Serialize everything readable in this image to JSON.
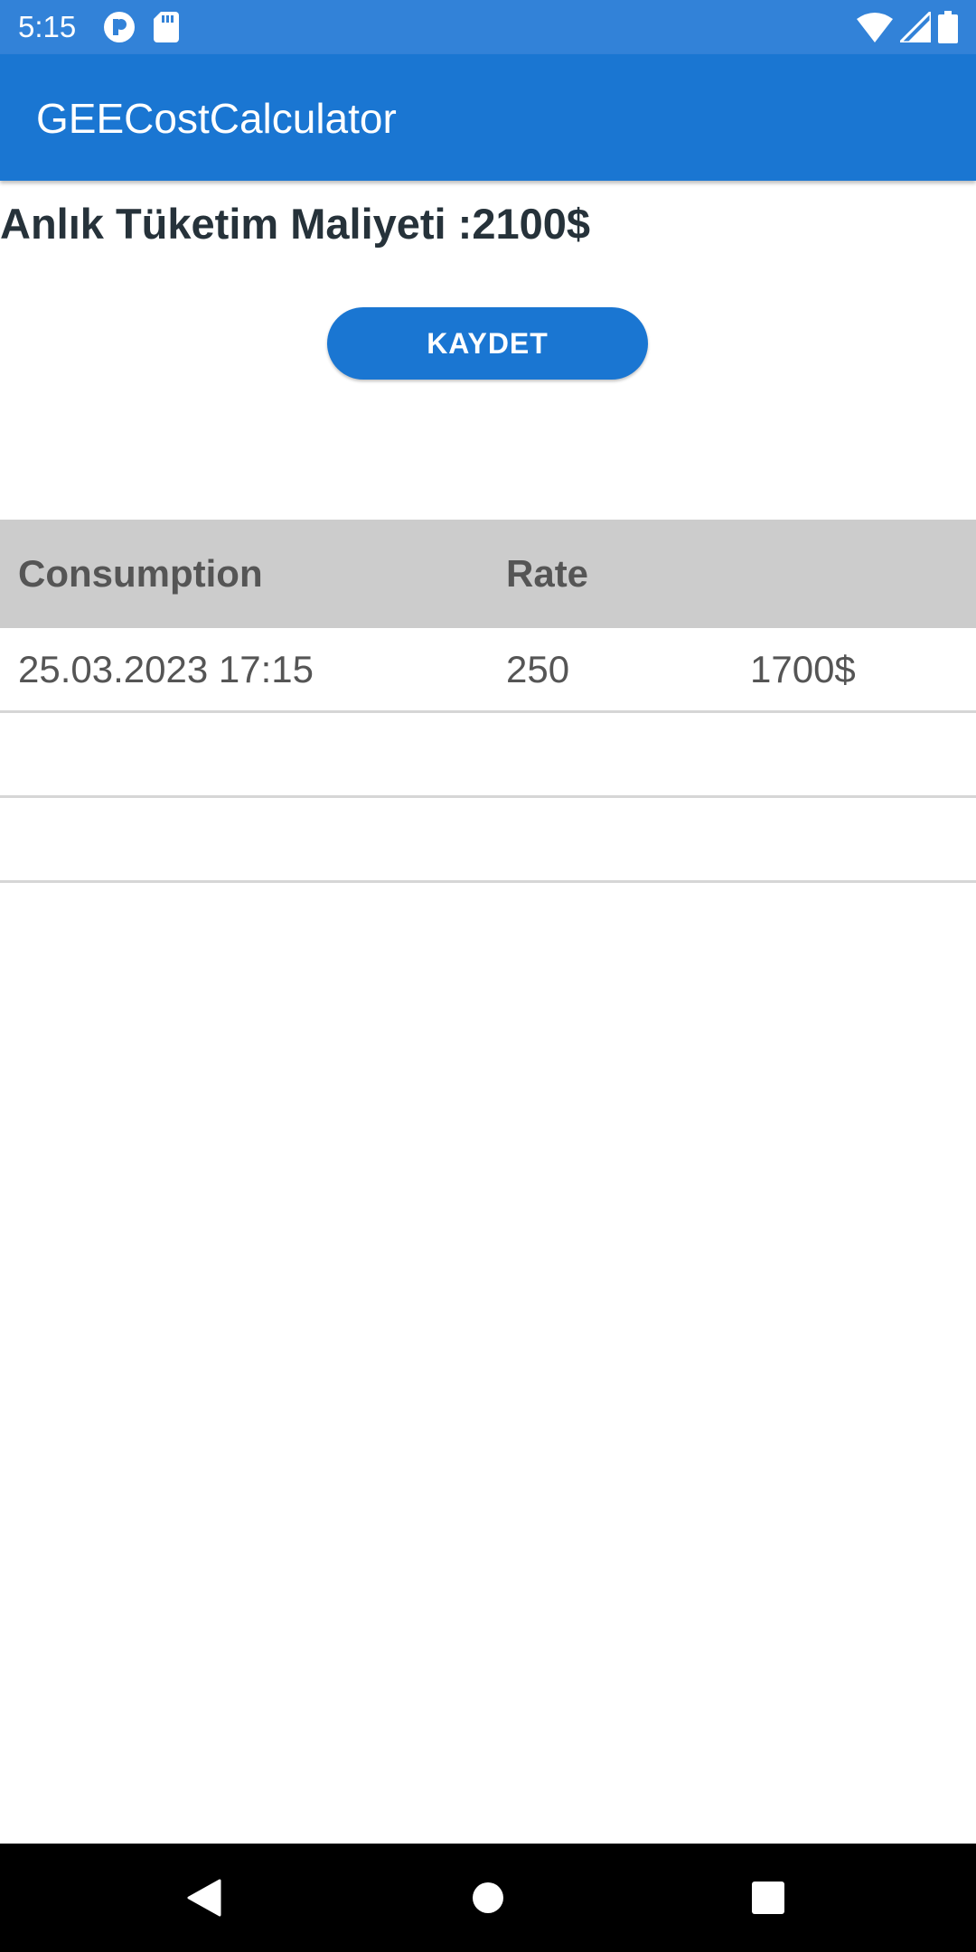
{
  "status_bar": {
    "time": "5:15",
    "background": "#3282d8",
    "left_icons": [
      "notification-app-icon",
      "sd-card-icon"
    ],
    "right_icons": [
      "wifi-icon",
      "cell-signal-icon",
      "battery-icon"
    ]
  },
  "app_bar": {
    "title": "GEECostCalculator",
    "background": "#1a76d2"
  },
  "main": {
    "cost_text": "Anlık Tüketim Maliyeti :2100$",
    "save_button_label": "KAYDET"
  },
  "table": {
    "headers": [
      "Consumption",
      "Rate",
      ""
    ],
    "rows": [
      [
        "25.03.2023 17:15",
        "250",
        "1700$"
      ],
      [
        "",
        "",
        ""
      ],
      [
        "",
        "",
        ""
      ]
    ]
  },
  "nav_bar": {
    "buttons": [
      "back-icon",
      "home-icon",
      "recents-icon"
    ]
  }
}
